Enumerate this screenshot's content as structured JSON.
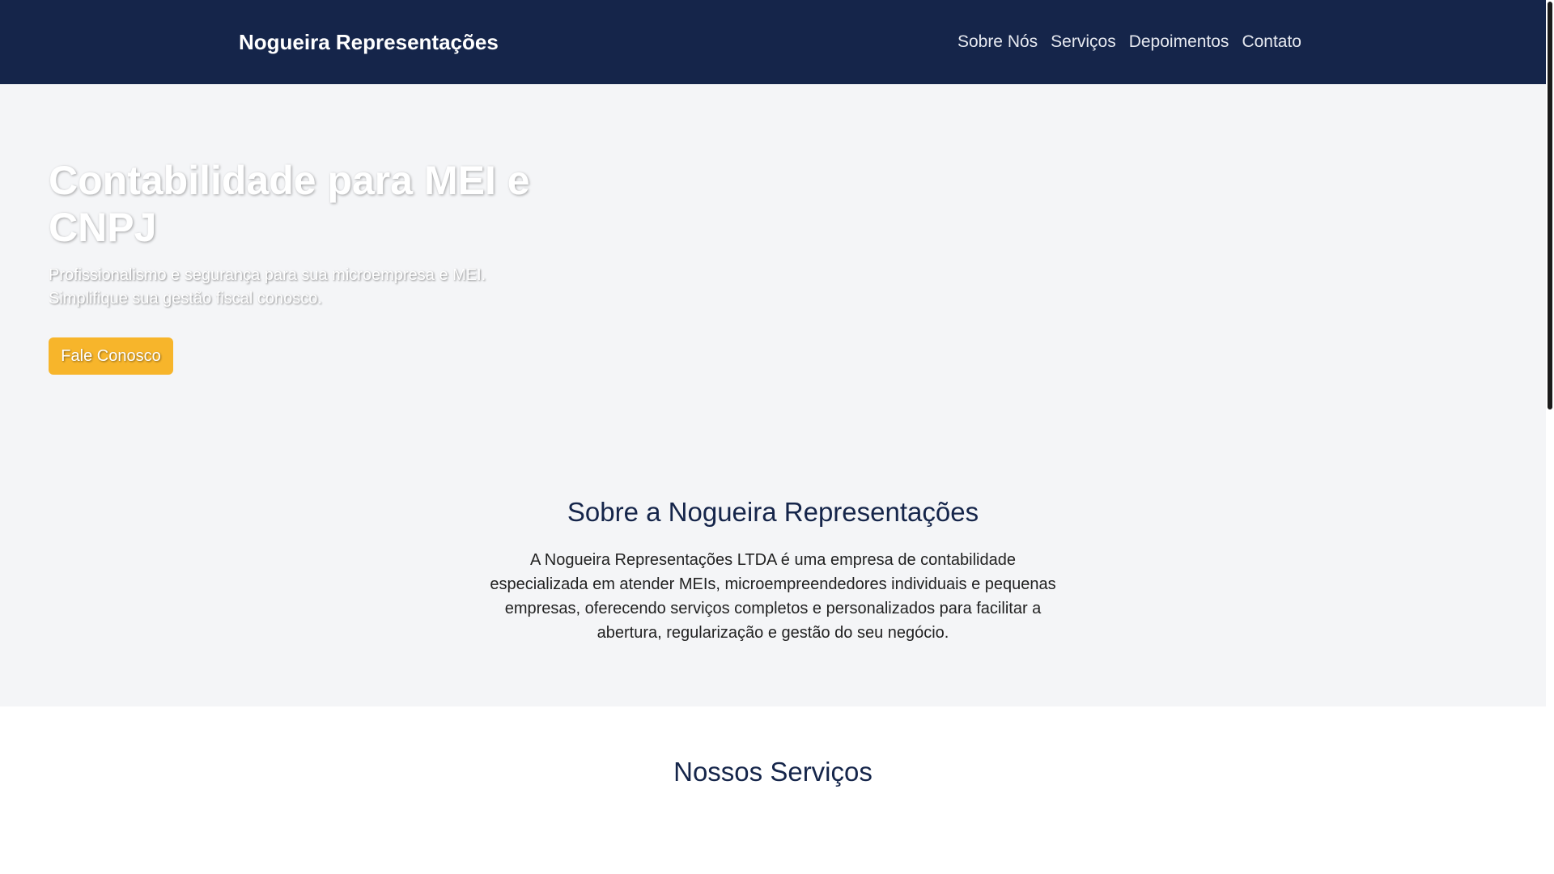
{
  "header": {
    "brand": "Nogueira Representações",
    "nav": [
      {
        "label": "Sobre Nós"
      },
      {
        "label": "Serviços"
      },
      {
        "label": "Depoimentos"
      },
      {
        "label": "Contato"
      }
    ]
  },
  "hero": {
    "title": "Contabilidade para MEI e CNPJ",
    "subtitle": "Profissionalismo e segurança para sua microempresa e MEI. Simplifique sua gestão fiscal conosco.",
    "cta_label": "Fale Conosco"
  },
  "about": {
    "title": "Sobre a Nogueira Representações",
    "text": "A Nogueira Representações LTDA é uma empresa de contabilidade especializada em atender MEIs, microempreendedores individuais e pequenas empresas, oferecendo serviços completos e personalizados para facilitar a abertura, regularização e gestão do seu negócio."
  },
  "services": {
    "title": "Nossos Serviços"
  },
  "colors": {
    "header_bg": "#15254a",
    "section_bg": "#f4f5f7",
    "accent": "#f7b52b",
    "heading": "#15254a"
  }
}
